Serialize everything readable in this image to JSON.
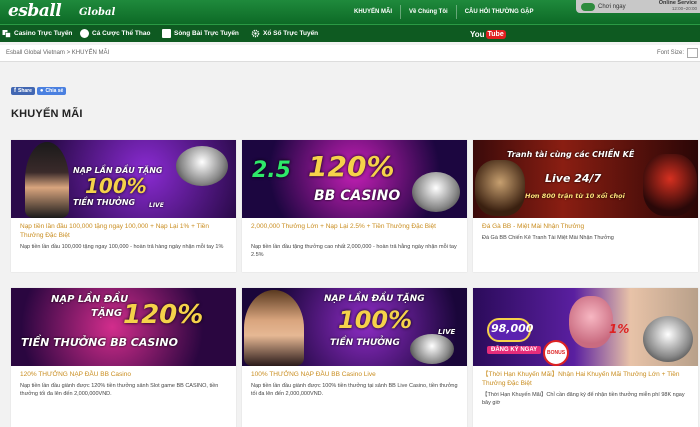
{
  "header": {
    "logo": "esball",
    "logo_sub": "Global",
    "nav": [
      "KHUYẾN MÃI",
      "Về Chúng Tôi",
      "CÂU HỎI THƯỜNG GẶP"
    ],
    "play_label": "Chơi ngay",
    "online_service": "Online Service",
    "online_hours": "12:00~20:00"
  },
  "main_nav": {
    "items": [
      "Casino Trực Tuyến",
      "Cá Cược Thể Thao",
      "Sòng Bài Trực Tuyến",
      "Xổ Số Trực Tuyến"
    ],
    "youtube_you": "You",
    "youtube_tube": "Tube"
  },
  "breadcrumb": {
    "home": "Esball Global Vietnam",
    "separator": ">",
    "current": "KHUYẾN MÃI",
    "font_size_label": "Font Size:"
  },
  "share": {
    "share_label": "Share",
    "chia_se_label": "Chia sẻ"
  },
  "page_title": "KHUYẾN MÃI",
  "cards": [
    {
      "banner_lines": [
        "NẠP LẦN ĐẦU TẶNG",
        "100%",
        "TIỀN THƯỞNG",
        "LIVE"
      ],
      "title": "Nạp tiền lần đầu 100,000 tặng ngay 100,000 + Nạp Lại 1% + Tiền Thưởng Đặc Biệt",
      "desc": "Nạp tiền lần đầu 100,000 tặng ngay 100,000 - hoàn trả hàng ngày nhận mỗi tay 1%"
    },
    {
      "banner_lines": [
        "120%",
        "BB CASINO"
      ],
      "title": "2,000,000 Thưởng Lớn + Nạp Lại 2.5% + Tiền Thưởng Đặc Biệt",
      "desc": "Nạp tiền lần đầu tặng thưởng cao nhất 2,000,000 - hoàn trả hằng ngày nhận mỗi tay 2.5%"
    },
    {
      "banner_lines": [
        "Tranh tài cùng các CHIẾN KÊ",
        "Live 24/7",
        "Hơn 800 trận từ 10 xổi chọi"
      ],
      "title": "Đá Gà BB - Miệt Mài Nhận Thưởng",
      "desc": "Đá Gà BB Chiến Kê Tranh Tài Miệt Mài Nhận Thưởng"
    },
    {
      "banner_lines": [
        "NẠP LẦN ĐẦU",
        "TẶNG",
        "120%",
        "TIỀN THƯỞNG BB CASINO"
      ],
      "title": "120% THƯỞNG NẠP ĐẦU BB Casino",
      "desc": "Nạp tiền lần đầu giành được 120% tiền thưởng sảnh Slot game BB CASINO, tiền thưởng tối đa lên đến 2,000,000VND."
    },
    {
      "banner_lines": [
        "NẠP LẦN ĐẦU TẶNG",
        "100%",
        "TIỀN THƯỞNG",
        "LIVE"
      ],
      "title": "100% THƯỞNG NẠP ĐẦU BB Casino Live",
      "desc": "Nạp tiền lần đầu giành được 100% tiền thưởng tại sảnh BB Live Casino, tiền thưởng tối đa lên đến 2,000,000VND."
    },
    {
      "banner_lines": [
        "98,000",
        "ĐĂNG KÝ NGAY",
        "BONUS",
        "1%"
      ],
      "title": "【Thời Hạn Khuyến Mãi】Nhận Hai Khuyến Mãi Thưởng Lớn + Tiền Thưởng Đặc Biệt",
      "desc": "【Thời Hạn Khuyến Mãi】Chỉ cần đăng ký để nhận tiền thưởng miễn phí 98K ngay bây giờ"
    }
  ],
  "colors": {
    "header_green": "#0d6a26",
    "caption_gold": "#c98d1f",
    "youtube_red": "#e02020"
  }
}
